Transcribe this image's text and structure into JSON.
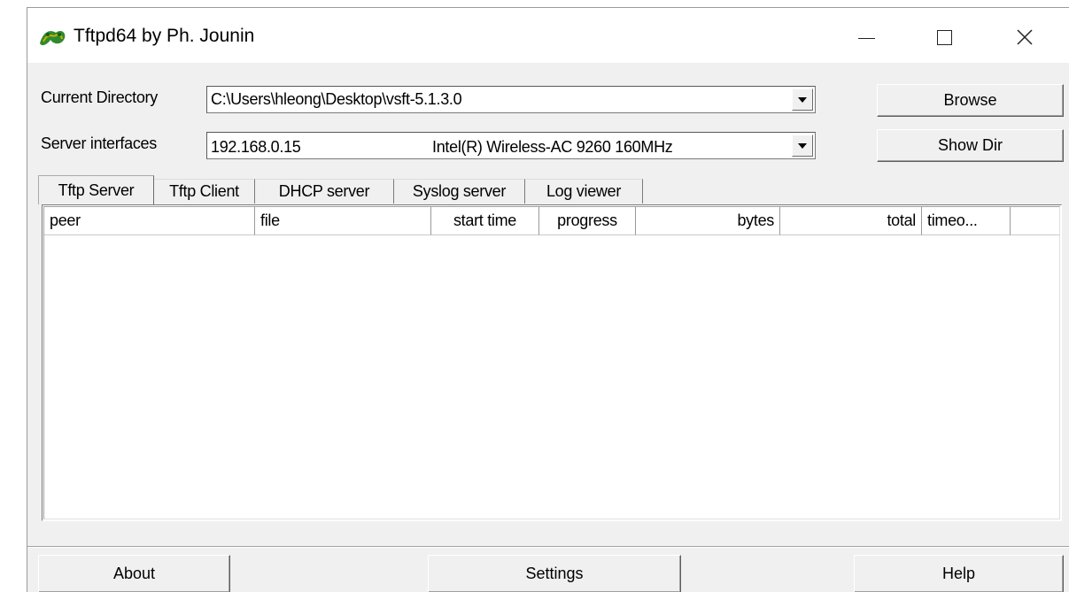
{
  "window": {
    "title": "Tftpd64 by Ph. Jounin"
  },
  "controls": {
    "current_directory_label": "Current Directory",
    "current_directory_value": "C:\\Users\\hleong\\Desktop\\vsft-5.1.3.0",
    "server_interfaces_label": "Server interfaces",
    "server_interface_ip": "192.168.0.15",
    "server_interface_name": "Intel(R) Wireless-AC 9260 160MHz",
    "browse_label": "Browse",
    "show_dir_label": "Show Dir"
  },
  "tabs": [
    "Tftp Server",
    "Tftp Client",
    "DHCP server",
    "Syslog server",
    "Log viewer"
  ],
  "active_tab": "Tftp Server",
  "table": {
    "columns": [
      "peer",
      "file",
      "start time",
      "progress",
      "bytes",
      "total",
      "timeo..."
    ],
    "rows": []
  },
  "footer": {
    "about_label": "About",
    "settings_label": "Settings",
    "help_label": "Help"
  }
}
